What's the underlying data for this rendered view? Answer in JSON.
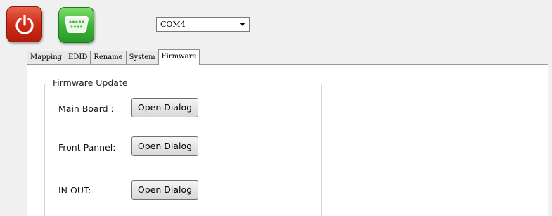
{
  "toolbar": {
    "power_icon": "power-icon",
    "serial_icon": "serial-port-icon",
    "com_port": {
      "selected": "COM4"
    }
  },
  "tabs": [
    {
      "label": "Mapping"
    },
    {
      "label": "EDID"
    },
    {
      "label": "Rename"
    },
    {
      "label": "System"
    },
    {
      "label": "Firmware",
      "active": true
    }
  ],
  "firmware": {
    "group_title": "Firmware Update",
    "rows": [
      {
        "label": "Main Board :",
        "button": "Open Dialog"
      },
      {
        "label": "Front Pannel:",
        "button": "Open Dialog"
      },
      {
        "label": "IN OUT:",
        "button": "Open Dialog"
      }
    ]
  },
  "colors": {
    "power_button": "#d0301b",
    "serial_button": "#3fb53a"
  }
}
